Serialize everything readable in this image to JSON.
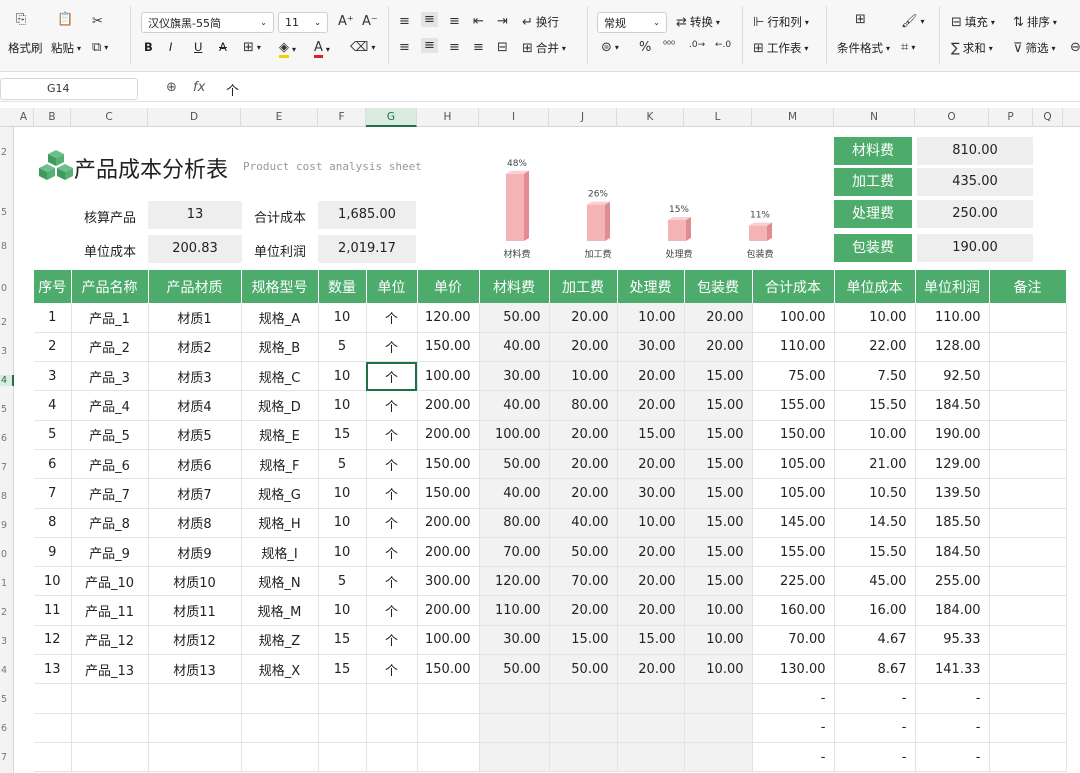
{
  "toolbar": {
    "format_painter": "格式刷",
    "paste": "粘贴",
    "font_name": "汉仪旗黑-55简",
    "font_size": "11",
    "wrap": "换行",
    "merge": "合并",
    "number_format": "常规",
    "convert": "转换",
    "rows_cols": "行和列",
    "worksheet": "工作表",
    "cond_format": "条件格式",
    "fill": "填充",
    "sort": "排序",
    "sum": "求和",
    "filter": "筛选"
  },
  "formula_bar": {
    "cell_ref": "G14",
    "fx": "fx",
    "content": "个"
  },
  "columns": [
    "A",
    "B",
    "C",
    "D",
    "E",
    "F",
    "G",
    "H",
    "I",
    "J",
    "K",
    "L",
    "M",
    "N",
    "O",
    "P",
    "Q"
  ],
  "selected_column": "G",
  "row_numbers": [
    "2",
    "",
    "5",
    "",
    "8",
    "",
    "0",
    "2",
    "3",
    "4",
    "5",
    "6",
    "7",
    "8",
    "9",
    "0",
    "1",
    "2",
    "3",
    "4",
    "5",
    "6",
    "7"
  ],
  "report": {
    "title": "产品成本分析表",
    "subtitle": "Product cost analysis sheet",
    "calc_product_label": "核算产品",
    "calc_product_value": "13",
    "total_cost_label": "合计成本",
    "total_cost_value": "1,685.00",
    "unit_cost_label": "单位成本",
    "unit_cost_value": "200.83",
    "unit_profit_label": "单位利润",
    "unit_profit_value": "2,019.17"
  },
  "cost_items": [
    {
      "label": "材料费",
      "value": "810.00"
    },
    {
      "label": "加工费",
      "value": "435.00"
    },
    {
      "label": "处理费",
      "value": "250.00"
    },
    {
      "label": "包装费",
      "value": "190.00"
    }
  ],
  "chart_data": {
    "type": "bar",
    "categories": [
      "材料费",
      "加工费",
      "处理费",
      "包装费"
    ],
    "values": [
      48,
      26,
      15,
      11
    ],
    "data_labels": [
      "48%",
      "26%",
      "15%",
      "11%"
    ],
    "color": "#f4b4b6"
  },
  "table": {
    "headers": [
      "序号",
      "产品名称",
      "产品材质",
      "规格型号",
      "数量",
      "单位",
      "单价",
      "材料费",
      "加工费",
      "处理费",
      "包装费",
      "合计成本",
      "单位成本",
      "单位利润",
      "备注"
    ],
    "rows": [
      [
        "1",
        "产品_1",
        "材质1",
        "规格_A",
        "10",
        "个",
        "120.00",
        "50.00",
        "20.00",
        "10.00",
        "20.00",
        "100.00",
        "10.00",
        "110.00",
        ""
      ],
      [
        "2",
        "产品_2",
        "材质2",
        "规格_B",
        "5",
        "个",
        "150.00",
        "40.00",
        "20.00",
        "30.00",
        "20.00",
        "110.00",
        "22.00",
        "128.00",
        ""
      ],
      [
        "3",
        "产品_3",
        "材质3",
        "规格_C",
        "10",
        "个",
        "100.00",
        "30.00",
        "10.00",
        "20.00",
        "15.00",
        "75.00",
        "7.50",
        "92.50",
        ""
      ],
      [
        "4",
        "产品_4",
        "材质4",
        "规格_D",
        "10",
        "个",
        "200.00",
        "40.00",
        "80.00",
        "20.00",
        "15.00",
        "155.00",
        "15.50",
        "184.50",
        ""
      ],
      [
        "5",
        "产品_5",
        "材质5",
        "规格_E",
        "15",
        "个",
        "200.00",
        "100.00",
        "20.00",
        "15.00",
        "15.00",
        "150.00",
        "10.00",
        "190.00",
        ""
      ],
      [
        "6",
        "产品_6",
        "材质6",
        "规格_F",
        "5",
        "个",
        "150.00",
        "50.00",
        "20.00",
        "20.00",
        "15.00",
        "105.00",
        "21.00",
        "129.00",
        ""
      ],
      [
        "7",
        "产品_7",
        "材质7",
        "规格_G",
        "10",
        "个",
        "150.00",
        "40.00",
        "20.00",
        "30.00",
        "15.00",
        "105.00",
        "10.50",
        "139.50",
        ""
      ],
      [
        "8",
        "产品_8",
        "材质8",
        "规格_H",
        "10",
        "个",
        "200.00",
        "80.00",
        "40.00",
        "10.00",
        "15.00",
        "145.00",
        "14.50",
        "185.50",
        ""
      ],
      [
        "9",
        "产品_9",
        "材质9",
        "规格_I",
        "10",
        "个",
        "200.00",
        "70.00",
        "50.00",
        "20.00",
        "15.00",
        "155.00",
        "15.50",
        "184.50",
        ""
      ],
      [
        "10",
        "产品_10",
        "材质10",
        "规格_N",
        "5",
        "个",
        "300.00",
        "120.00",
        "70.00",
        "20.00",
        "15.00",
        "225.00",
        "45.00",
        "255.00",
        ""
      ],
      [
        "11",
        "产品_11",
        "材质11",
        "规格_M",
        "10",
        "个",
        "200.00",
        "110.00",
        "20.00",
        "20.00",
        "10.00",
        "160.00",
        "16.00",
        "184.00",
        ""
      ],
      [
        "12",
        "产品_12",
        "材质12",
        "规格_Z",
        "15",
        "个",
        "100.00",
        "30.00",
        "15.00",
        "15.00",
        "10.00",
        "70.00",
        "4.67",
        "95.33",
        ""
      ],
      [
        "13",
        "产品_13",
        "材质13",
        "规格_X",
        "15",
        "个",
        "150.00",
        "50.00",
        "50.00",
        "20.00",
        "10.00",
        "130.00",
        "8.67",
        "141.33",
        ""
      ],
      [
        "",
        "",
        "",
        "",
        "",
        "",
        "",
        "",
        "",
        "",
        "",
        "-",
        "-",
        "-",
        ""
      ],
      [
        "",
        "",
        "",
        "",
        "",
        "",
        "",
        "",
        "",
        "",
        "",
        "-",
        "-",
        "-",
        ""
      ],
      [
        "",
        "",
        "",
        "",
        "",
        "",
        "",
        "",
        "",
        "",
        "",
        "-",
        "-",
        "-",
        ""
      ]
    ]
  }
}
